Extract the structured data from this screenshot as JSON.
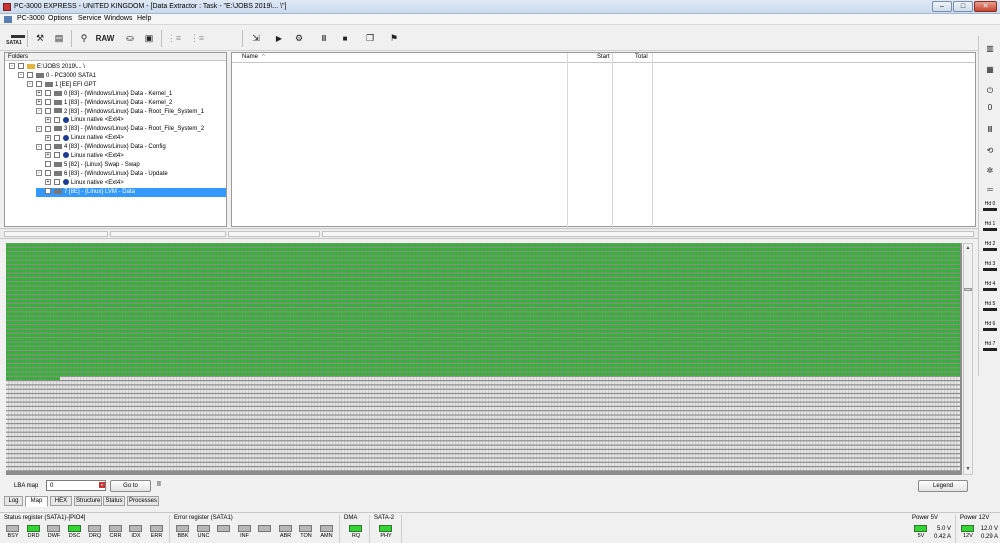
{
  "window": {
    "title": "PC-3000 EXPRESS - UNITED KINGDOM - [Data Extractor : Task - \"E:\\JOBS 2019\\... \\\"]",
    "controls": {
      "minimize": "–",
      "maximize": "□",
      "close": "✕"
    }
  },
  "menu": {
    "items": [
      {
        "id": "pc3000",
        "label": "PC-3000"
      },
      {
        "id": "options",
        "label": "Options"
      },
      {
        "id": "service",
        "label": "Service"
      },
      {
        "id": "windows",
        "label": "Windows"
      },
      {
        "id": "help",
        "label": "Help"
      }
    ]
  },
  "toolbar": {
    "satai_label": "SATA1",
    "raw_label": "RAW",
    "icons": [
      "tools-icon",
      "task-icon",
      "binoculars-icon",
      "raw-button",
      "drive-icon",
      "camera-icon",
      "tree-icon",
      "tree-disabled-icon",
      "export-icon",
      "play-icon",
      "bike-icon",
      "pause-icon",
      "stop-icon",
      "copy-icon",
      "run-icon"
    ]
  },
  "folders": {
    "title": "Folders",
    "rows": [
      {
        "text": "E:\\JOBS 2019\\... \\",
        "indent": 0,
        "expander": "-",
        "icon": "folder",
        "selected": false
      },
      {
        "text": "0 - PC3000 SATA1",
        "indent": 1,
        "expander": "-",
        "icon": "drive",
        "selected": false
      },
      {
        "text": "1 [EE] EFI GPT",
        "indent": 2,
        "expander": "-",
        "icon": "partition",
        "selected": false
      },
      {
        "text": "0 [83] - {Windows/Linux} Data - Kernel_1",
        "indent": 3,
        "expander": "+",
        "icon": "partition",
        "selected": false
      },
      {
        "text": "1 [83] - {Windows/Linux} Data - Kernel_2",
        "indent": 3,
        "expander": "+",
        "icon": "partition",
        "selected": false
      },
      {
        "text": "2 [83] - {Windows/Linux} Data - Root_File_System_1",
        "indent": 3,
        "expander": "-",
        "icon": "partition",
        "selected": false
      },
      {
        "text": "Linux native <Ext4>",
        "indent": 4,
        "expander": "+",
        "icon": "info",
        "selected": false
      },
      {
        "text": "3 [83] - {Windows/Linux} Data - Root_File_System_2",
        "indent": 3,
        "expander": "-",
        "icon": "partition",
        "selected": false
      },
      {
        "text": "Linux native <Ext4>",
        "indent": 4,
        "expander": "+",
        "icon": "info",
        "selected": false
      },
      {
        "text": "4 [83] - {Windows/Linux} Data - Config",
        "indent": 3,
        "expander": "-",
        "icon": "partition",
        "selected": false
      },
      {
        "text": "Linux native <Ext4>",
        "indent": 4,
        "expander": "+",
        "icon": "info",
        "selected": false
      },
      {
        "text": "5 [82] - {Linux} Swap - Swap",
        "indent": 3,
        "expander": "",
        "icon": "partition",
        "selected": false
      },
      {
        "text": "6 [83] - {Windows/Linux} Data - Update",
        "indent": 3,
        "expander": "-",
        "icon": "partition",
        "selected": false
      },
      {
        "text": "Linux native <Ext4>",
        "indent": 4,
        "expander": "+",
        "icon": "info",
        "selected": false
      },
      {
        "text": "7 [8E] - {Linux} LVM - Data",
        "indent": 3,
        "expander": "",
        "icon": "partition",
        "selected": true
      }
    ]
  },
  "list": {
    "columns": {
      "name": "Name",
      "start": "Start",
      "total": "Total"
    }
  },
  "map": {
    "filled_fraction": 0.586,
    "colors": {
      "read": "#2fb52f",
      "unread": "#e8e8e8",
      "grid": "#8c8c8c"
    }
  },
  "mapbar": {
    "lba_label": "LBA map",
    "lba_value": "0",
    "goto_label": "Go to",
    "pause_label": "II",
    "legend_label": "Legend"
  },
  "tabs": [
    {
      "label": "Log",
      "active": false
    },
    {
      "label": "Map",
      "active": true
    },
    {
      "label": "HEX",
      "active": false
    },
    {
      "label": "Structure",
      "active": false
    },
    {
      "label": "Status",
      "active": false
    },
    {
      "label": "Processes",
      "active": false
    }
  ],
  "status_register": {
    "title": "Status register (SATA1)-[PIO4]",
    "leds": [
      {
        "label": "BSY",
        "on": false
      },
      {
        "label": "DRD",
        "on": true
      },
      {
        "label": "DWF",
        "on": false
      },
      {
        "label": "DSC",
        "on": true
      },
      {
        "label": "DRQ",
        "on": false
      },
      {
        "label": "CRR",
        "on": false
      },
      {
        "label": "IDX",
        "on": false
      },
      {
        "label": "ERR",
        "on": false
      }
    ]
  },
  "error_register": {
    "title": "Error register (SATA1)",
    "leds": [
      {
        "label": "BBK",
        "on": false
      },
      {
        "label": "UNC",
        "on": false
      },
      {
        "label": "",
        "on": false
      },
      {
        "label": "INF",
        "on": false
      },
      {
        "label": "",
        "on": false
      },
      {
        "label": "ABR",
        "on": false
      },
      {
        "label": "TON",
        "on": false
      },
      {
        "label": "AMN",
        "on": false
      }
    ]
  },
  "dma": {
    "title": "DMA",
    "leds": [
      {
        "label": "RQ",
        "on": true
      }
    ]
  },
  "sata2": {
    "title": "SATA-2",
    "leds": [
      {
        "label": "PHY",
        "on": true
      }
    ]
  },
  "power5": {
    "title": "Power 5V",
    "led_label": "5V",
    "on": true,
    "voltage": "5.0 V",
    "current": "0.42 A"
  },
  "power12": {
    "title": "Power 12V",
    "led_label": "12V",
    "on": true,
    "voltage": "12.0 V",
    "current": "0.29 A"
  },
  "right_panel": {
    "hd_labels": [
      "Hd 0",
      "Hd 1",
      "Hd 2",
      "Hd 3",
      "Hd 4",
      "Hd 5",
      "Hd 6",
      "Hd 7"
    ],
    "pause_label": "II"
  }
}
